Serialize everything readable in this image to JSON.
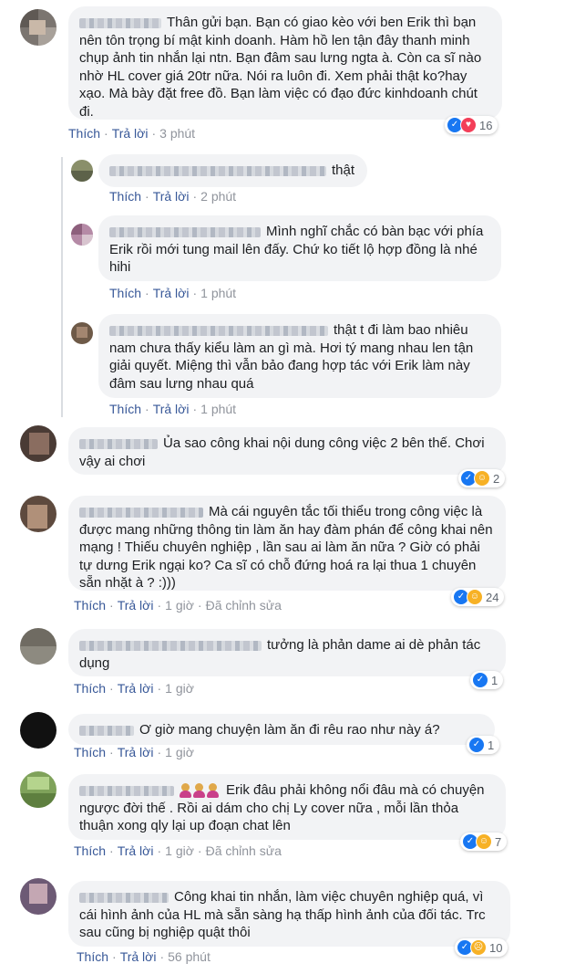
{
  "actions": {
    "like": "Thích",
    "reply": "Trả lời",
    "edited": "Đã chỉnh sửa"
  },
  "comments": [
    {
      "text": "Thân gửi bạn. Bạn có giao kèo với ben Erik thì bạn nên tôn trọng bí mật kinh doanh. Hàm hồ len tận đây thanh minh chụp ảnh tin nhắn lại ntn. Bạn đâm sau lưng ngta à. Còn ca sĩ nào nhờ HL cover giá 20tr nữa. Nói ra luôn đi. Xem phải thật ko?hay xạo. Mà bày đặt free đồ. Bạn làm việc có đạo đức kinhdoanh chút đi.",
      "time": "3 phút",
      "reactions": "16"
    },
    {
      "text": "thật",
      "time": "2 phút"
    },
    {
      "text": "Mình nghĩ chắc có bàn bạc với phía Erik rồi mới tung mail lên đấy. Chứ ko tiết lộ hợp đồng là nhé hihi",
      "time": "1 phút"
    },
    {
      "text": "thật t đi làm bao nhiêu nam chưa thấy kiểu làm an gì mà. Hơi tý mang nhau len tận giải quyết. Miệng thì vẫn bảo đang hợp tác với Erik làm này đâm sau lưng nhau quá",
      "time": "1 phút"
    },
    {
      "text": "Ủa sao công khai nội dung công việc 2 bên thế. Chơi vậy ai chơi",
      "time": "",
      "reactions": "2"
    },
    {
      "text": "Mà cái nguyên tắc tối thiểu trong công việc là được mang những thông tin làm ăn hay đàm phán để công khai nên mạng ! Thiếu chuyên nghiệp , lần sau ai làm ăn nữa ? Giờ có phải tự dưng Erik ngại ko? Ca sĩ có chỗ đứng hoá ra lại thua 1 chuyên sẵn nhặt à ? :)))",
      "time": "1 giờ",
      "reactions": "24"
    },
    {
      "text": "tưởng là phản dame ai dè phản tác dụng",
      "time": "1 giờ",
      "reactions": "1"
    },
    {
      "text": "Ơ giờ mang chuyện làm ăn đi rêu rao như này á?",
      "time": "1 giờ",
      "reactions": "1"
    },
    {
      "text": "Erik đâu phải không nổi đâu mà có chuyện ngược đời thế . Rồi ai dám cho chị Ly cover nữa , mỗi lần thỏa thuận xong qly lại up đoạn chat lên",
      "time": "1 giờ",
      "reactions": "7"
    },
    {
      "text": "Công khai tin nhắn, làm việc chuyên nghiệp quá, vì cái hình ảnh của HL mà sẵn sàng hạ thấp hình ảnh của đối tác. Trc sau cũng bị nghiệp quật thôi",
      "time": "56 phút",
      "reactions": "10"
    }
  ],
  "colors": {
    "bubble": "#f2f3f5",
    "link": "#385898",
    "meta": "#90949c",
    "like": "#1877f2",
    "love": "#f33e58",
    "haha": "#f7b125"
  },
  "icons": [
    "like-icon",
    "love-icon",
    "haha-icon",
    "sad-icon",
    "person-emoji-icon"
  ]
}
